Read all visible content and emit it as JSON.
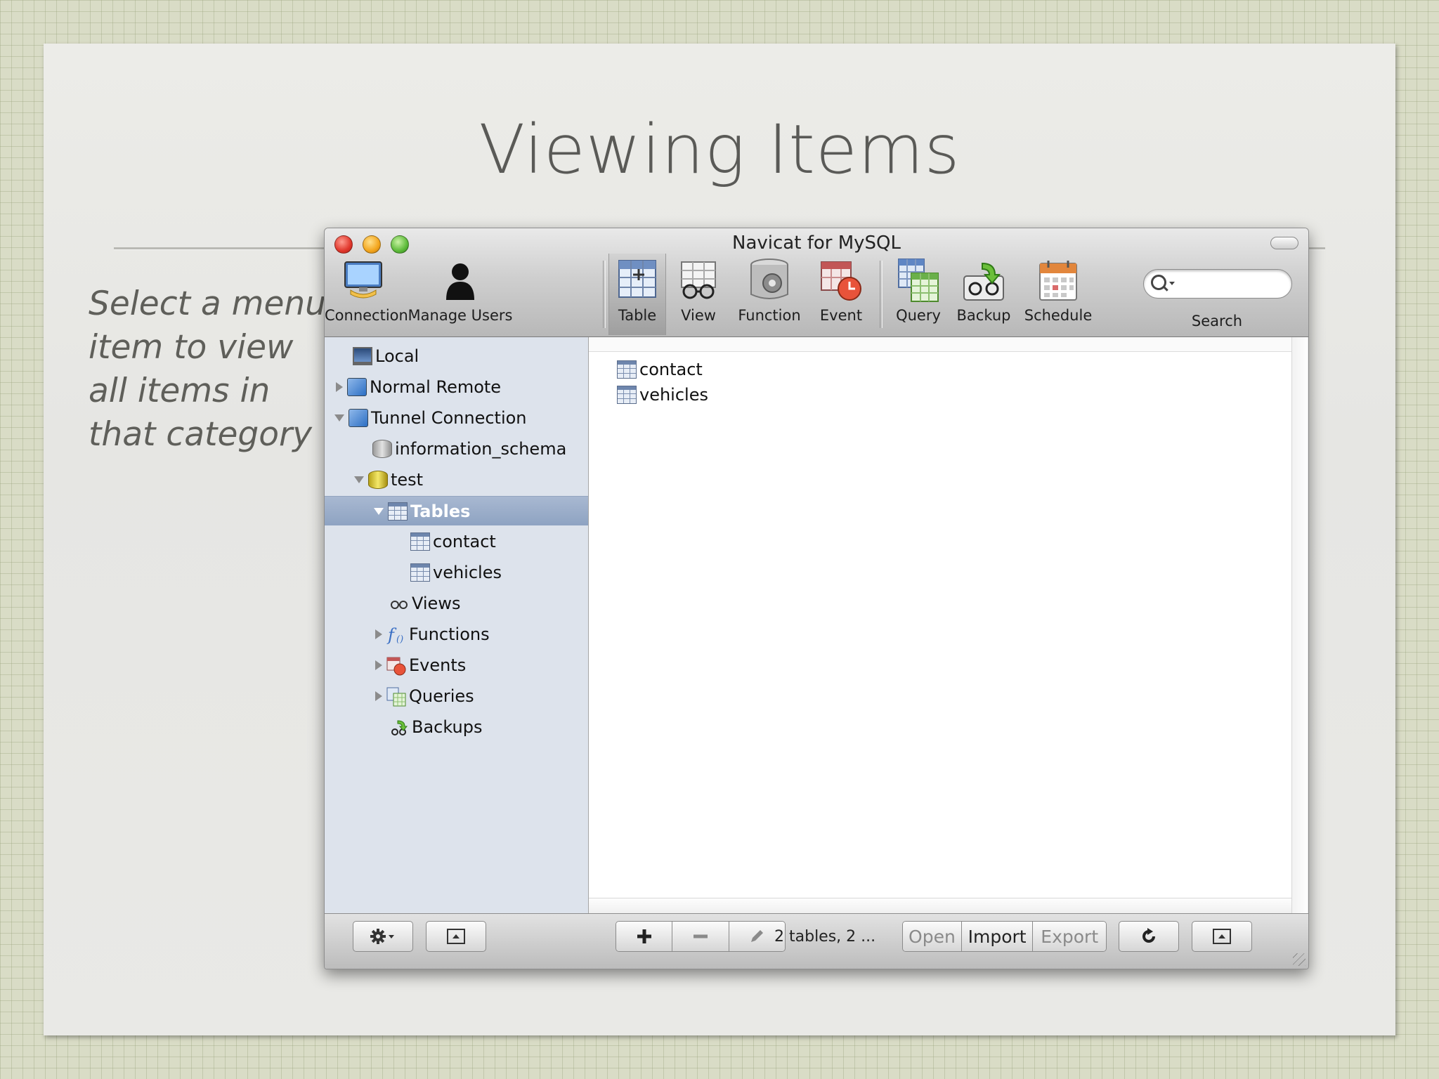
{
  "slide": {
    "title": "Viewing Items",
    "caption": "Select a menu item to view all items in that category"
  },
  "window": {
    "title": "Navicat for MySQL",
    "toolbar": [
      {
        "label": "Connection",
        "icon": "connection-icon"
      },
      {
        "label": "Manage Users",
        "icon": "user-icon"
      },
      {
        "label": "Table",
        "icon": "table-icon",
        "selected": true
      },
      {
        "label": "View",
        "icon": "view-glasses-icon"
      },
      {
        "label": "Function",
        "icon": "function-icon"
      },
      {
        "label": "Event",
        "icon": "event-icon"
      },
      {
        "label": "Query",
        "icon": "query-icon"
      },
      {
        "label": "Backup",
        "icon": "backup-icon"
      },
      {
        "label": "Schedule",
        "icon": "schedule-icon"
      }
    ],
    "search": {
      "label": "Search",
      "value": ""
    },
    "sidebar": {
      "items": [
        {
          "label": "Local"
        },
        {
          "label": "Normal Remote"
        },
        {
          "label": "Tunnel Connection"
        },
        {
          "label": "information_schema"
        },
        {
          "label": "test"
        },
        {
          "label": "Tables",
          "selected": true
        },
        {
          "label": "contact"
        },
        {
          "label": "vehicles"
        },
        {
          "label": "Views"
        },
        {
          "label": "Functions"
        },
        {
          "label": "Events"
        },
        {
          "label": "Queries"
        },
        {
          "label": "Backups"
        }
      ]
    },
    "content": {
      "items": [
        {
          "label": "contact"
        },
        {
          "label": "vehicles"
        }
      ]
    },
    "bottombar": {
      "status": "2 tables, 2 ...",
      "open_label": "Open",
      "import_label": "Import",
      "export_label": "Export"
    }
  },
  "colors": {
    "selection": "#8ea3c2",
    "sidebar_bg": "#dde3ec"
  }
}
